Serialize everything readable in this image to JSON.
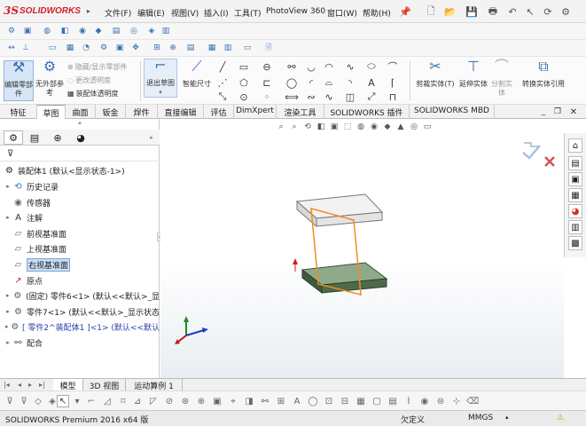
{
  "app": {
    "logo_prefix": "3S",
    "logo_text": "SOLIDWORKS"
  },
  "menu": {
    "items": [
      "文件(F)",
      "编辑(E)",
      "视图(V)",
      "插入(I)",
      "工具(T)",
      "PhotoView 360",
      "窗口(W)",
      "帮助(H)"
    ]
  },
  "command_manager": {
    "big_buttons": [
      {
        "label": "编辑零部件",
        "icon": "edit-component-icon"
      },
      {
        "label": "无外部参考",
        "icon": "no-external-refs-icon"
      },
      {
        "label": "退出草图",
        "icon": "exit-sketch-icon"
      },
      {
        "label": "智能尺寸",
        "icon": "smart-dimension-icon"
      }
    ],
    "small_items": [
      "隐藏/显示零部件",
      "更改透明度",
      "装配体透明度"
    ],
    "right_buttons": [
      {
        "label": "剪裁实体(T)",
        "icon": "trim-entities-icon"
      },
      {
        "label": "延伸实体",
        "icon": "extend-entities-icon"
      },
      {
        "label": "分割实体",
        "icon": "split-entities-icon"
      },
      {
        "label": "转换实体引用",
        "icon": "convert-entities-icon"
      }
    ]
  },
  "tabs": [
    "特征",
    "草图",
    "曲面",
    "钣金",
    "焊件",
    "直接编辑",
    "评估",
    "DimXpert",
    "渲染工具",
    "SOLIDWORKS 插件",
    "SOLIDWORKS MBD"
  ],
  "active_tab": "草图",
  "feature_tree": {
    "root": "装配体1 (默认<显示状态-1>)",
    "rows": [
      {
        "label": "历史记录",
        "arrow": "▸",
        "icon": "history-icon"
      },
      {
        "label": "传感器",
        "arrow": "",
        "icon": "sensor-icon"
      },
      {
        "label": "注解",
        "arrow": "▸",
        "icon": "annotation-icon"
      },
      {
        "label": "前视基准面",
        "arrow": "",
        "icon": "plane-icon"
      },
      {
        "label": "上视基准面",
        "arrow": "",
        "icon": "plane-icon"
      },
      {
        "label": "右视基准面",
        "arrow": "",
        "icon": "plane-icon",
        "selected": true
      },
      {
        "label": "原点",
        "arrow": "",
        "icon": "origin-icon"
      },
      {
        "label": "(固定) 零件6<1> (默认<<默认>_显",
        "arrow": "▸",
        "icon": "part-icon"
      },
      {
        "label": "零件7<1> (默认<<默认>_显示状态",
        "arrow": "▸",
        "icon": "part-icon"
      },
      {
        "label": "[ 零件2^装配体1 ]<1> (默认<<默认",
        "arrow": "▸",
        "icon": "part-icon",
        "blue": true
      },
      {
        "label": "配合",
        "arrow": "▸",
        "icon": "mate-icon"
      }
    ]
  },
  "bottom_tabs": [
    "模型",
    "3D 视图",
    "运动算例 1"
  ],
  "status": {
    "app_version": "SOLIDWORKS Premium 2016 x64 版",
    "constraint": "欠定义",
    "units": "MMGS"
  }
}
